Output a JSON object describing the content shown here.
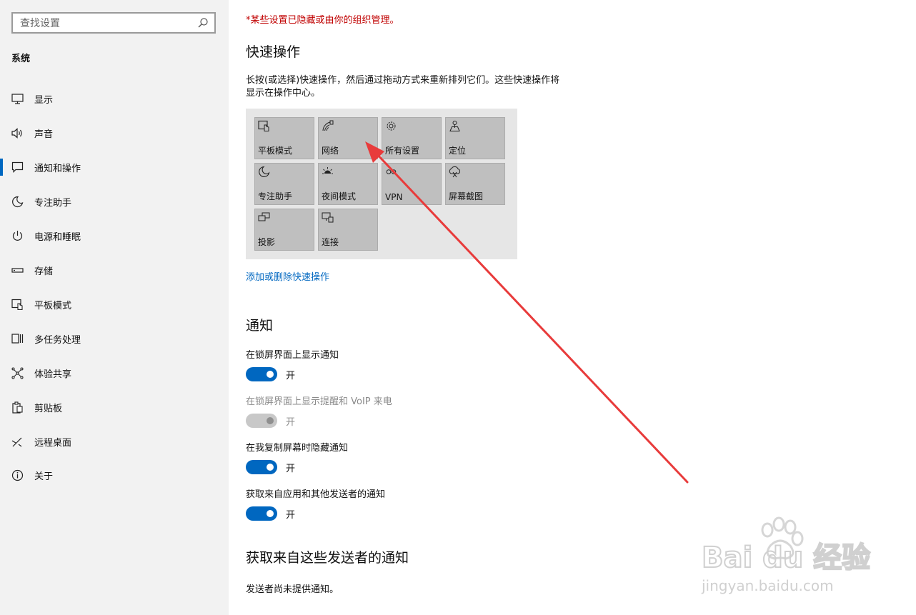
{
  "sidebar": {
    "search_placeholder": "查找设置",
    "section_title": "系统",
    "items": [
      {
        "label": "显示",
        "icon": "monitor-icon"
      },
      {
        "label": "声音",
        "icon": "speaker-icon"
      },
      {
        "label": "通知和操作",
        "icon": "notification-icon"
      },
      {
        "label": "专注助手",
        "icon": "moon-icon"
      },
      {
        "label": "电源和睡眠",
        "icon": "power-icon"
      },
      {
        "label": "存储",
        "icon": "storage-icon"
      },
      {
        "label": "平板模式",
        "icon": "tablet-mode-icon"
      },
      {
        "label": "多任务处理",
        "icon": "multitask-icon"
      },
      {
        "label": "体验共享",
        "icon": "share-icon"
      },
      {
        "label": "剪贴板",
        "icon": "clipboard-icon"
      },
      {
        "label": "远程桌面",
        "icon": "remote-desktop-icon"
      },
      {
        "label": "关于",
        "icon": "info-icon"
      }
    ],
    "active_index": 2
  },
  "main": {
    "org_note": "*某些设置已隐藏或由你的组织管理。",
    "quick_actions": {
      "title": "快速操作",
      "description": "长按(或选择)快速操作，然后通过拖动方式来重新排列它们。这些快速操作将显示在操作中心。",
      "tiles": [
        {
          "label": "平板模式",
          "icon": "tablet-mode-icon"
        },
        {
          "label": "网络",
          "icon": "network-icon"
        },
        {
          "label": "所有设置",
          "icon": "gear-icon"
        },
        {
          "label": "定位",
          "icon": "location-icon"
        },
        {
          "label": "专注助手",
          "icon": "moon-icon"
        },
        {
          "label": "夜间模式",
          "icon": "brightness-icon"
        },
        {
          "label": "VPN",
          "icon": "vpn-icon"
        },
        {
          "label": "屏幕截图",
          "icon": "screenshot-icon"
        },
        {
          "label": "投影",
          "icon": "project-icon"
        },
        {
          "label": "连接",
          "icon": "connect-icon"
        }
      ],
      "link": "添加或删除快速操作"
    },
    "notifications": {
      "title": "通知",
      "settings": [
        {
          "label": "在锁屏界面上显示通知",
          "state": "开",
          "enabled": true
        },
        {
          "label": "在锁屏界面上显示提醒和 VoIP 来电",
          "state": "开",
          "enabled": false
        },
        {
          "label": "在我复制屏幕时隐藏通知",
          "state": "开",
          "enabled": true
        },
        {
          "label": "获取来自应用和其他发送者的通知",
          "state": "开",
          "enabled": true
        }
      ]
    },
    "senders": {
      "title": "获取来自这些发送者的通知",
      "note": "发送者尚未提供通知。"
    }
  },
  "watermark": {
    "text": "jingyan.baidu.com",
    "logo": "Bai du 经验"
  },
  "colors": {
    "accent": "#0067c0",
    "annotation_arrow": "#e83b3b",
    "warning_text": "#c00000"
  }
}
